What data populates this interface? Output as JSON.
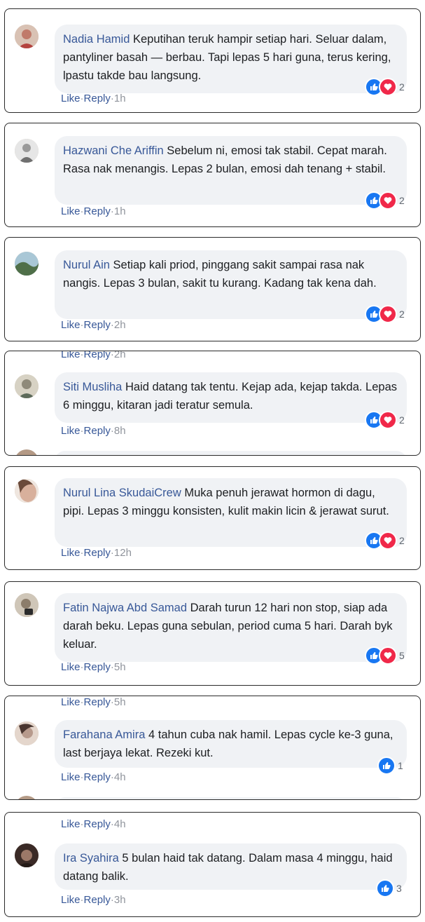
{
  "ui": {
    "like_label": "Like",
    "reply_label": "Reply",
    "sep": "·"
  },
  "comments": [
    {
      "name": "Nadia Hamid",
      "text": "Keputihan teruk hampir setiap hari. Seluar dalam, pantyliner basah — berbau. Tapi lepas 5 hari guna, terus kering, lpastu takde bau langsung.",
      "time": "1h",
      "reactions": "2",
      "avatar_color": "#c07a6a"
    },
    {
      "name": "Hazwani Che Ariffin",
      "text": "Sebelum ni, emosi tak stabil. Cepat marah. Rasa nak menangis. Lepas 2 bulan, emosi dah tenang + stabil.",
      "time": "1h",
      "reactions": "2",
      "avatar_color": "#9a9a9a"
    },
    {
      "name": "Nurul Ain",
      "text": "Setiap kali priod, pinggang sakit sampai rasa nak nangis. Lepas 3 bulan, sakit tu kurang. Kadang tak kena dah.",
      "time": "2h",
      "reactions": "2",
      "avatar_color": "#5b7b58"
    },
    {
      "name": "Siti Musliha",
      "text": "Haid datang tak tentu. Kejap ada, kejap takda. Lepas 6 minggu, kitaran jadi teratur semula.",
      "time": "8h",
      "reactions": "2",
      "avatar_color": "#8f8a7a"
    },
    {
      "name": "Nurul Lina SkudaiCrew",
      "text": "Muka penuh jerawat hormon di dagu, pipi. Lepas 3 minggu konsisten, kulit makin licin & jerawat surut.",
      "time": "12h",
      "reactions": "2",
      "avatar_color": "#d8b09c"
    },
    {
      "name": "Fatin Najwa Abd Samad",
      "text": "Darah turun 12 hari non stop, siap ada darah beku. Lepas guna sebulan, period cuma 5 hari. Darah byk keluar.",
      "time": "5h",
      "reactions": "5",
      "avatar_color": "#8c7d6b"
    },
    {
      "name": "Farahana Amira",
      "text": "4 tahun cuba nak hamil. Lepas cycle ke-3 guna, last berjaya lekat. Rezeki kut.",
      "time": "4h",
      "reactions": "1",
      "avatar_color": "#b79a8c"
    },
    {
      "name": "Ira Syahira",
      "text": "5 bulan haid tak datang. Dalam masa 4 minggu, haid datang balik.",
      "time": "3h",
      "reactions": "3",
      "avatar_color": "#6a4f45"
    }
  ],
  "ghosts": {
    "g4_time": "2h",
    "g7_time": "5h",
    "g8_time": "4h"
  }
}
